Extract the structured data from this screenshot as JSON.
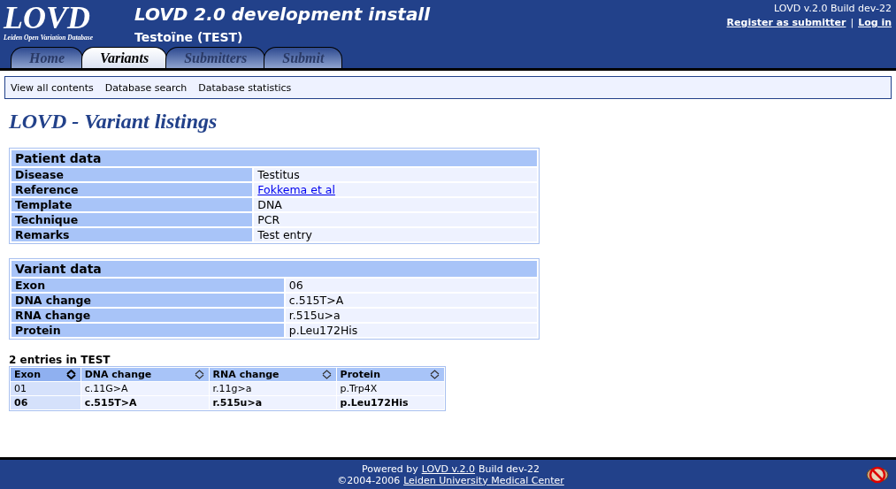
{
  "header": {
    "logo": "LOVD",
    "logo_subtitle": "Leiden Open Variation Database",
    "title": "LOVD 2.0 development install",
    "subtitle": "Testoïne (TEST)",
    "build": "LOVD v.2.0 Build dev-22",
    "links": [
      "Register as submitter",
      "Log in"
    ],
    "separator": "|"
  },
  "tabs": [
    {
      "label": "Home",
      "selected": false
    },
    {
      "label": "Variants",
      "selected": true
    },
    {
      "label": "Submitters",
      "selected": false
    },
    {
      "label": "Submit",
      "selected": false
    }
  ],
  "submenu": [
    "View all contents",
    "Database search",
    "Database statistics"
  ],
  "page_title": "LOVD - Variant listings",
  "detail_tables": [
    {
      "title": "Patient data",
      "rows": [
        {
          "label": "Disease",
          "value": "Testitus",
          "kind": "text"
        },
        {
          "label": "Reference",
          "value": "Fokkema et al",
          "kind": "link"
        },
        {
          "label": "Template",
          "value": "DNA",
          "kind": "text"
        },
        {
          "label": "Technique",
          "value": "PCR",
          "kind": "text"
        },
        {
          "label": "Remarks",
          "value": "Test entry",
          "kind": "text"
        }
      ]
    },
    {
      "title": "Variant data",
      "rows": [
        {
          "label": "Exon",
          "value": "06",
          "kind": "text"
        },
        {
          "label": "DNA change",
          "value": "c.515T>A",
          "kind": "text"
        },
        {
          "label": "RNA change",
          "value": "r.515u>a",
          "kind": "text"
        },
        {
          "label": "Protein",
          "value": "p.Leu172His",
          "kind": "text"
        }
      ]
    }
  ],
  "entries": {
    "caption": "2 entries in TEST",
    "columns": [
      {
        "label": "Exon",
        "sorted": true
      },
      {
        "label": "DNA change",
        "sorted": false
      },
      {
        "label": "RNA change",
        "sorted": false
      },
      {
        "label": "Protein",
        "sorted": false
      }
    ],
    "rows": [
      {
        "cells": [
          "01",
          "c.11G>A",
          "r.11g>a",
          "p.Trp4X"
        ],
        "current": false
      },
      {
        "cells": [
          "06",
          "c.515T>A",
          "r.515u>a",
          "p.Leu172His"
        ],
        "current": true
      }
    ]
  },
  "footer": {
    "lines": [
      [
        {
          "text": "Powered by",
          "link": false
        },
        {
          "text": "LOVD v.2.0",
          "link": true
        },
        {
          "text": "Build dev-22",
          "link": false
        }
      ],
      [
        {
          "text": "©2004-2006",
          "link": false
        },
        {
          "text": "Leiden University Medical Center",
          "link": true
        }
      ]
    ]
  }
}
